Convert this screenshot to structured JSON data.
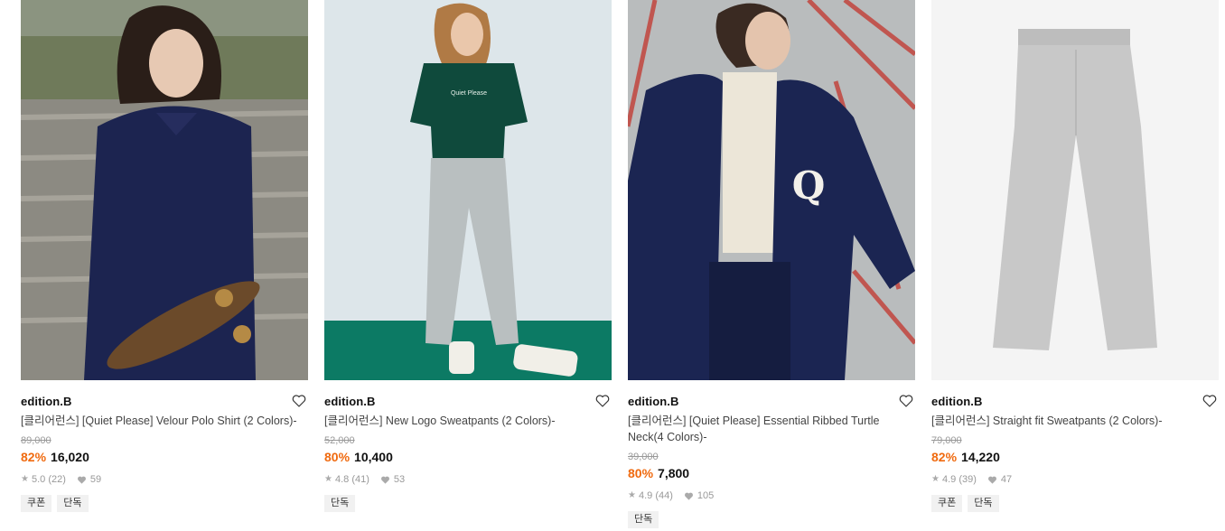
{
  "products": [
    {
      "brand": "edition.B",
      "title": "[클리어런스] [Quiet Please] Velour Polo Shirt (2 Colors)-",
      "original_price": "89,000",
      "discount": "82%",
      "price": "16,020",
      "rating": "5.0",
      "reviews": "(22)",
      "likes": "59",
      "tags": [
        "쿠폰",
        "단독"
      ],
      "image": "woman-velour-polo-skateboard-photo"
    },
    {
      "brand": "edition.B",
      "title": "[클리어런스] New Logo Sweatpants (2 Colors)-",
      "original_price": "52,000",
      "discount": "80%",
      "price": "10,400",
      "rating": "4.8",
      "reviews": "(41)",
      "likes": "53",
      "tags": [
        "단독"
      ],
      "image": "woman-green-polo-grey-sweatpants-photo",
      "logo_text": "Quiet Please"
    },
    {
      "brand": "edition.B",
      "title": "[클리어런스] [Quiet Please] Essential Ribbed Turtle Neck(4 Colors)-",
      "original_price": "39,000",
      "discount": "80%",
      "price": "7,800",
      "rating": "4.9",
      "reviews": "(44)",
      "likes": "105",
      "tags": [
        "단독"
      ],
      "image": "woman-turtleneck-fleece-jacket-photo",
      "logo_text": "Q"
    },
    {
      "brand": "edition.B",
      "title": "[클리어런스] Straight fit Sweatpants (2 Colors)-",
      "original_price": "79,000",
      "discount": "82%",
      "price": "14,220",
      "rating": "4.9",
      "reviews": "(39)",
      "likes": "47",
      "tags": [
        "쿠폰",
        "단독"
      ],
      "image": "grey-sweatpants-flat-photo"
    }
  ],
  "icons": {
    "wishlist": "heart-outline-icon",
    "rating": "star-icon",
    "likes": "heart-filled-icon"
  },
  "colors": {
    "discount": "#f06a0f",
    "strike": "#999999"
  }
}
